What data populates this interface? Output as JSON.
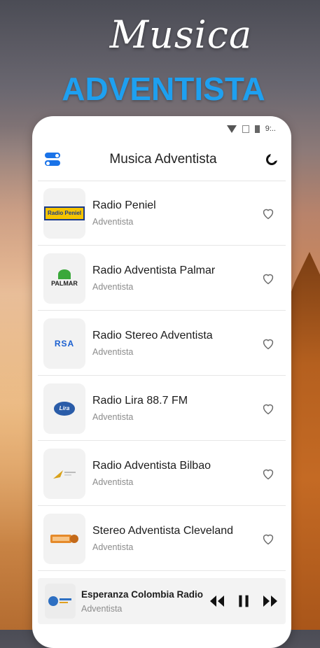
{
  "promo": {
    "title_line1": "Musica",
    "title_line2": "ADVENTISTA"
  },
  "status_bar": {
    "time": "9:.."
  },
  "app_bar": {
    "title": "Musica Adventista",
    "left_icon": "theme-toggle-icon",
    "right_icon": "moon-icon"
  },
  "stations": [
    {
      "name": "Radio Peniel",
      "category": "Adventista",
      "logo_text": "Radio Peniel"
    },
    {
      "name": "Radio Adventista Palmar",
      "category": "Adventista",
      "logo_text": "PALMAR"
    },
    {
      "name": "Radio Stereo Adventista",
      "category": "Adventista",
      "logo_text": "RSA"
    },
    {
      "name": "Radio Lira 88.7 FM",
      "category": "Adventista",
      "logo_text": "Lira"
    },
    {
      "name": "Radio Adventista Bilbao",
      "category": "Adventista",
      "logo_text": ""
    },
    {
      "name": "Stereo Adventista Cleveland",
      "category": "Adventista",
      "logo_text": ""
    }
  ],
  "player": {
    "name": "Esperanza Colombia Radio",
    "category": "Adventista",
    "controls": [
      "rewind-icon",
      "pause-icon",
      "fast-forward-icon"
    ]
  },
  "colors": {
    "accent_blue": "#1a73e8",
    "promo_blue": "#1ea0f0",
    "text_dark": "#1c1c1c",
    "text_muted": "#8c8c8c"
  }
}
